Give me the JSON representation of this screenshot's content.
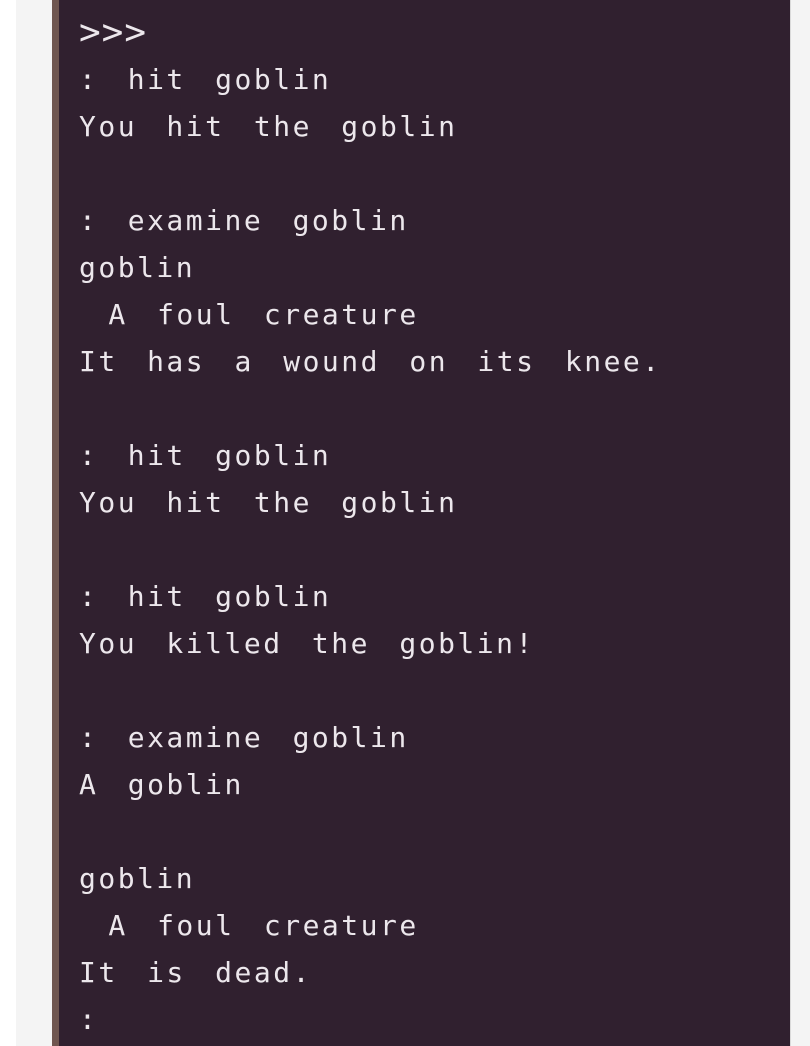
{
  "console": {
    "prompt": ">>>",
    "lines": [
      ": hit goblin",
      "You hit the goblin",
      "",
      ": examine goblin",
      "goblin",
      " A foul creature",
      "It has a wound on its knee.",
      "",
      ": hit goblin",
      "You hit the goblin",
      "",
      ": hit goblin",
      "You killed the goblin!",
      "",
      ": examine goblin",
      "A goblin",
      "",
      "goblin",
      " A foul creature",
      "It is dead.",
      ":"
    ]
  }
}
